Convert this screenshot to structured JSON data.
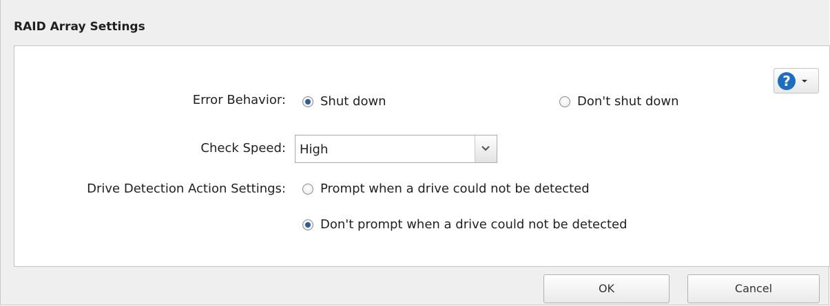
{
  "dialog": {
    "title": "RAID Array Settings"
  },
  "help": {
    "glyph": "?",
    "icon": "help-icon"
  },
  "error_behavior": {
    "label": "Error Behavior:",
    "options": [
      {
        "label": "Shut down",
        "checked": true
      },
      {
        "label": "Don't shut down",
        "checked": false
      }
    ]
  },
  "check_speed": {
    "label": "Check Speed:",
    "value": "High"
  },
  "drive_detection": {
    "label": "Drive Detection Action Settings:",
    "options": [
      {
        "label": "Prompt when a drive could not be detected",
        "checked": false
      },
      {
        "label": "Don't prompt when a drive could not be detected",
        "checked": true
      }
    ]
  },
  "buttons": {
    "ok_label": "OK",
    "cancel_label": "Cancel"
  },
  "colors": {
    "help_blue": "#1a6fc0",
    "radio_selected": "#2a5d9a"
  }
}
